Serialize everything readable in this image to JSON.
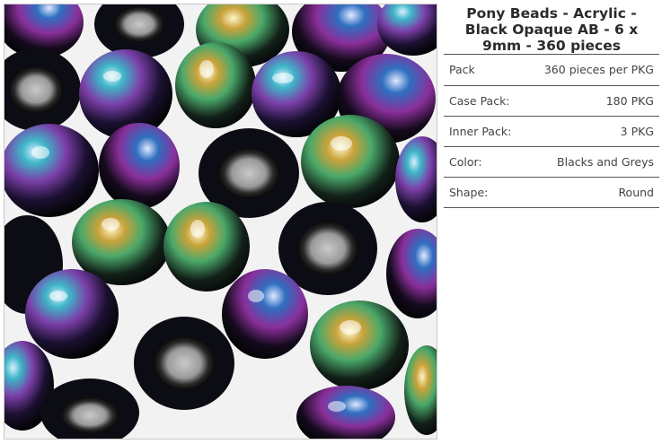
{
  "product": {
    "title": "Pony Beads - Acrylic - Black Opaque AB - 6 x 9mm - 360 pieces",
    "image_subject": "iridescent black pony beads"
  },
  "specs": [
    {
      "label": "Pack",
      "value": "360 pieces per PKG"
    },
    {
      "label": "Case Pack:",
      "value": "180 PKG"
    },
    {
      "label": "Inner Pack:",
      "value": "3 PKG"
    },
    {
      "label": "Color:",
      "value": "Blacks and Greys"
    },
    {
      "label": "Shape:",
      "value": "Round"
    }
  ],
  "colors": {
    "bead_base": "#0c0c14",
    "iridescent": [
      "#3fb6c9",
      "#7b3fa8",
      "#c9a23a",
      "#2f6fc0",
      "#4aa86a"
    ],
    "divider": "#555555"
  }
}
